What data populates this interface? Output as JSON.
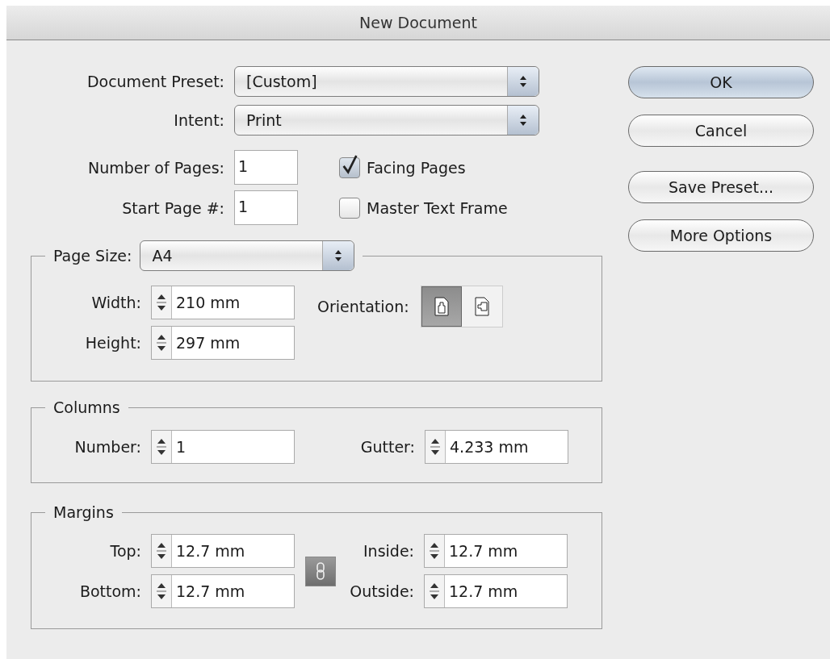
{
  "window": {
    "title": "New Document"
  },
  "document_preset": {
    "label": "Document Preset:",
    "value": "[Custom]"
  },
  "intent": {
    "label": "Intent:",
    "value": "Print"
  },
  "number_of_pages": {
    "label": "Number of Pages:",
    "value": "1"
  },
  "start_page": {
    "label": "Start Page #:",
    "value": "1"
  },
  "checkboxes": [
    {
      "label": "Facing Pages",
      "checked": true
    },
    {
      "label": "Master Text Frame",
      "checked": false
    }
  ],
  "page_size": {
    "label": "Page Size:",
    "value": "A4",
    "fields": [
      {
        "label": "Width:",
        "value": "210 mm"
      },
      {
        "label": "Height:",
        "value": "297 mm"
      }
    ],
    "orientation": {
      "label": "Orientation:",
      "options": [
        {
          "kind": "portrait",
          "selected": true
        },
        {
          "kind": "landscape",
          "selected": false
        }
      ]
    }
  },
  "columns": {
    "title": "Columns",
    "number": {
      "label": "Number:",
      "value": "1"
    },
    "gutter": {
      "label": "Gutter:",
      "value": "4.233 mm"
    }
  },
  "margins": {
    "title": "Margins",
    "left_fields": [
      {
        "label": "Top:",
        "value": "12.7 mm"
      },
      {
        "label": "Bottom:",
        "value": "12.7 mm"
      }
    ],
    "right_fields": [
      {
        "label": "Inside:",
        "value": "12.7 mm"
      },
      {
        "label": "Outside:",
        "value": "12.7 mm"
      }
    ],
    "linked": true
  },
  "buttons": [
    {
      "label": "OK",
      "default": true
    },
    {
      "label": "Cancel",
      "default": false
    },
    {
      "label": "Save Preset...",
      "default": false
    },
    {
      "label": "More Options",
      "default": false
    }
  ]
}
